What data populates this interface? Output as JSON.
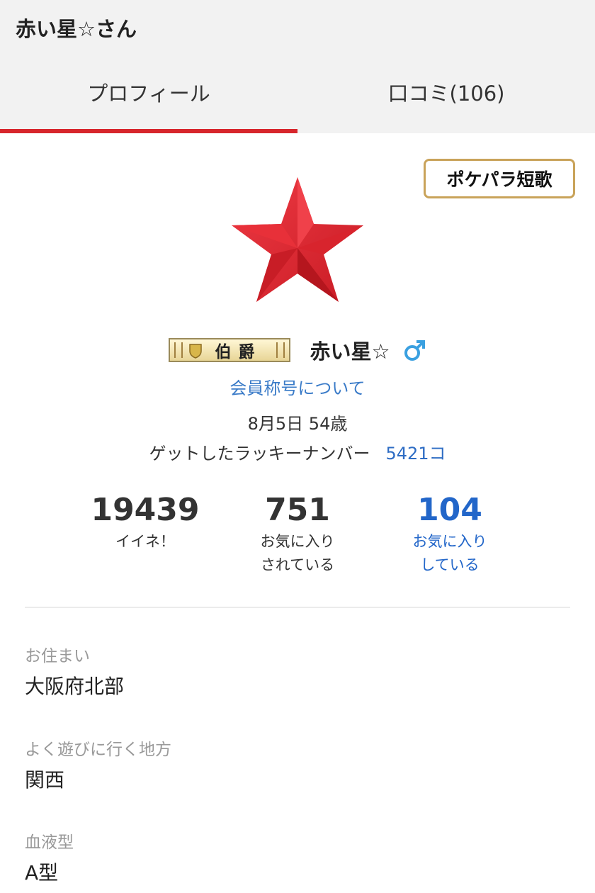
{
  "page": {
    "title": "赤い星☆さん"
  },
  "tabs": [
    {
      "label": "プロフィール",
      "active": true
    },
    {
      "label": "口コミ(106)",
      "active": false
    }
  ],
  "tanka_button": "ポケパラ短歌",
  "profile": {
    "avatar_icon": "red-star",
    "rank": "伯爵",
    "name": "赤い星☆",
    "gender_icon": "male-symbol",
    "title_link": "会員称号について",
    "birthday": "8月5日 54歳",
    "lucky_label": "ゲットしたラッキーナンバー",
    "lucky_value": "5421コ"
  },
  "stats": [
    {
      "value": "19439",
      "label1": "イイネ！",
      "label2": ""
    },
    {
      "value": "751",
      "label1": "お気に入り",
      "label2": "されている"
    },
    {
      "value": "104",
      "label1": "お気に入り",
      "label2": "している"
    }
  ],
  "fields": [
    {
      "label": "お住まい",
      "value": "大阪府北部"
    },
    {
      "label": "よく遊びに行く地方",
      "value": "関西"
    },
    {
      "label": "血液型",
      "value": "A型"
    }
  ],
  "colors": {
    "accent": "#d7262c",
    "link": "#2266c9",
    "gold_border": "#c9a35a",
    "male": "#3aa0e0"
  }
}
